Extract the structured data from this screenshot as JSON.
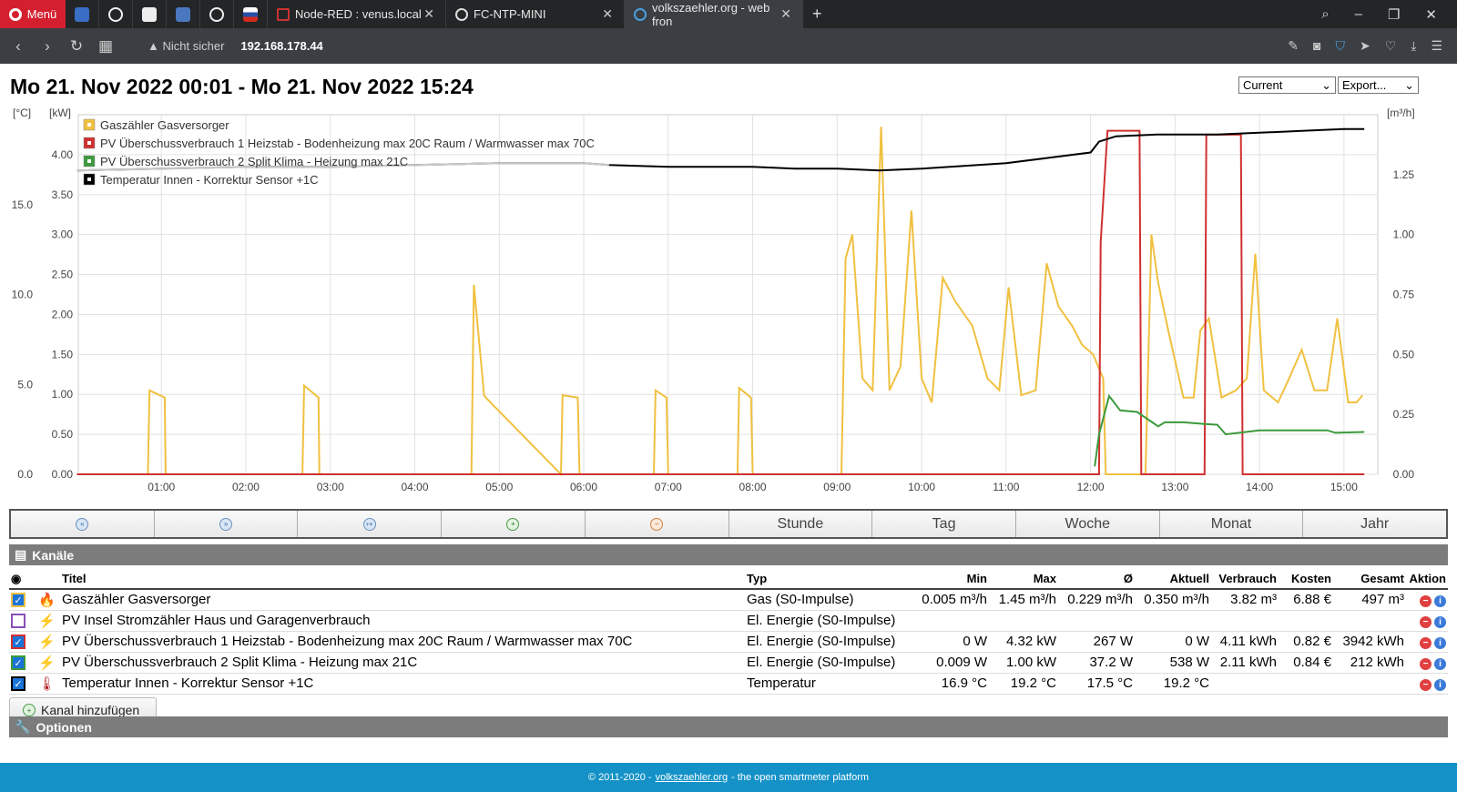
{
  "browser": {
    "menu_label": "Menü",
    "tabs": [
      {
        "title": "Node-RED : venus.local",
        "close": "✕"
      },
      {
        "title": "FC-NTP-MINI",
        "close": "✕"
      },
      {
        "title": "volkszaehler.org - web fron",
        "close": "✕"
      }
    ],
    "new_tab": "+",
    "security_label": "Nicht sicher",
    "url": "192.168.178.44"
  },
  "page": {
    "title": "Mo 21. Nov 2022 00:01 - Mo 21. Nov 2022 15:24",
    "mode_select": "Current",
    "export_select": "Export..."
  },
  "chart_data": {
    "type": "line",
    "x_range": [
      "00:01",
      "15:24"
    ],
    "x_ticks": [
      "01:00",
      "02:00",
      "03:00",
      "04:00",
      "05:00",
      "06:00",
      "07:00",
      "08:00",
      "09:00",
      "10:00",
      "11:00",
      "12:00",
      "13:00",
      "14:00",
      "15:00"
    ],
    "y_axes": {
      "temp": {
        "unit": "[°C]",
        "ticks": [
          "0.0",
          "5.0",
          "10.0",
          "15.0"
        ],
        "range": [
          0,
          20
        ]
      },
      "power": {
        "unit": "[kW]",
        "ticks": [
          "0.00",
          "0.50",
          "1.00",
          "1.50",
          "2.00",
          "2.50",
          "3.00",
          "3.50",
          "4.00"
        ],
        "range": [
          0,
          4.5
        ]
      },
      "gas": {
        "unit": "[m³/h]",
        "ticks": [
          "0.00",
          "0.25",
          "0.50",
          "0.75",
          "1.00",
          "1.25"
        ],
        "range": [
          0,
          1.5
        ]
      }
    },
    "legend_position": "top-left",
    "series": [
      {
        "name": "Gaszähler Gasversorger",
        "color": "#f0c040",
        "axis": "gas",
        "x": [
          0,
          0.84,
          0.86,
          1.04,
          1.05,
          2.67,
          2.69,
          2.86,
          2.87,
          4.67,
          4.7,
          4.82,
          4.84,
          5.73,
          5.75,
          5.93,
          5.95,
          6.83,
          6.85,
          6.98,
          7.0,
          7.82,
          7.84,
          7.98,
          8.0,
          9.05,
          9.1,
          9.18,
          9.3,
          9.42,
          9.52,
          9.62,
          9.75,
          9.88,
          10.0,
          10.12,
          10.25,
          10.4,
          10.6,
          10.78,
          10.92,
          11.03,
          11.18,
          11.35,
          11.48,
          11.62,
          11.78,
          11.9,
          12.03,
          12.15,
          12.18,
          12.65,
          12.72,
          12.8,
          12.92,
          13.1,
          13.22,
          13.3,
          13.4,
          13.55,
          13.72,
          13.85,
          13.95,
          14.05,
          14.22,
          14.35,
          14.5,
          14.65,
          14.8,
          14.92,
          15.05,
          15.15,
          15.22
        ],
        "y": [
          0,
          0,
          0.35,
          0.32,
          0,
          0,
          0.37,
          0.32,
          0,
          0,
          0.79,
          0.33,
          0.32,
          0,
          0.33,
          0.32,
          0,
          0,
          0.35,
          0.32,
          0,
          0,
          0.36,
          0.32,
          0,
          0,
          0.9,
          1.0,
          0.4,
          0.35,
          1.45,
          0.35,
          0.45,
          1.1,
          0.4,
          0.3,
          0.82,
          0.72,
          0.62,
          0.4,
          0.35,
          0.78,
          0.33,
          0.35,
          0.88,
          0.7,
          0.62,
          0.54,
          0.5,
          0.4,
          0.0,
          0.0,
          1.0,
          0.8,
          0.6,
          0.32,
          0.32,
          0.6,
          0.65,
          0.32,
          0.35,
          0.4,
          0.92,
          0.35,
          0.3,
          0.4,
          0.52,
          0.35,
          0.35,
          0.65,
          0.3,
          0.3,
          0.33
        ]
      },
      {
        "name": "PV Überschussverbrauch 1 Heizstab - Bodenheizung max 20C Raum / Warmwasser max 70C",
        "color": "#d03030",
        "axis": "power",
        "x": [
          0,
          12.1,
          12.12,
          12.2,
          12.58,
          12.6,
          13.35,
          13.37,
          13.78,
          13.8,
          15.24
        ],
        "y": [
          0,
          0,
          2.9,
          4.3,
          4.3,
          0,
          0,
          4.25,
          4.25,
          0,
          0
        ]
      },
      {
        "name": "PV Überschussverbrauch 2 Split Klima - Heizung max 21C",
        "color": "#3c9a3c",
        "axis": "power",
        "x": [
          12.05,
          12.1,
          12.22,
          12.35,
          12.55,
          12.8,
          12.88,
          13.1,
          13.35,
          13.5,
          13.6,
          14.0,
          14.5,
          14.8,
          14.9,
          15.24
        ],
        "y": [
          0.1,
          0.5,
          0.98,
          0.8,
          0.78,
          0.6,
          0.65,
          0.65,
          0.63,
          0.62,
          0.5,
          0.55,
          0.55,
          0.55,
          0.52,
          0.53
        ]
      },
      {
        "name": "Temperatur Innen - Korrektur Sensor +1C",
        "color": "#000000",
        "axis": "temp",
        "x": [
          0,
          1,
          2,
          3,
          4,
          5,
          6,
          6.3,
          7,
          8,
          8.5,
          9,
          9.5,
          10,
          11,
          11.5,
          12,
          12.1,
          12.3,
          12.8,
          13.5,
          14,
          14.5,
          15,
          15.24
        ],
        "y": [
          16.9,
          17.0,
          17.1,
          17.1,
          17.2,
          17.3,
          17.3,
          17.2,
          17.1,
          17.1,
          17.0,
          17.0,
          16.9,
          17.0,
          17.3,
          17.6,
          17.9,
          18.5,
          18.8,
          18.9,
          18.9,
          19.0,
          19.1,
          19.2,
          19.2
        ]
      }
    ]
  },
  "nav": {
    "buttons": [
      "«",
      "»",
      "↦",
      "+",
      "−",
      "Stunde",
      "Tag",
      "Woche",
      "Monat",
      "Jahr"
    ]
  },
  "channels": {
    "section_title": "Kanäle",
    "headers": {
      "title": "Titel",
      "type": "Typ",
      "min": "Min",
      "max": "Max",
      "avg": "Ø",
      "current": "Aktuell",
      "consumption": "Verbrauch",
      "cost": "Kosten",
      "total": "Gesamt",
      "action": "Aktion"
    },
    "rows": [
      {
        "color": "#f0c040",
        "checked": true,
        "icon": "flame-icon",
        "title": "Gaszähler Gasversorger",
        "type": "Gas (S0-Impulse)",
        "min": "0.005 m³/h",
        "max": "1.45 m³/h",
        "avg": "0.229 m³/h",
        "current": "0.350 m³/h",
        "consumption": "3.82 m³",
        "cost": "6.88 €",
        "total": "497 m³"
      },
      {
        "color": "#8a4fb8",
        "checked": false,
        "icon": "lightning-icon",
        "title": "PV Insel Stromzähler Haus und Garagenverbrauch",
        "type": "El. Energie (S0-Impulse)",
        "min": "",
        "max": "",
        "avg": "",
        "current": "",
        "consumption": "",
        "cost": "",
        "total": ""
      },
      {
        "color": "#d03030",
        "checked": true,
        "icon": "lightning-icon",
        "title": "PV Überschussverbrauch 1 Heizstab - Bodenheizung max 20C Raum / Warmwasser max 70C",
        "type": "El. Energie (S0-Impulse)",
        "min": "0 W",
        "max": "4.32 kW",
        "avg": "267 W",
        "current": "0 W",
        "consumption": "4.11 kWh",
        "cost": "0.82 €",
        "total": "3942 kWh"
      },
      {
        "color": "#3c9a3c",
        "checked": true,
        "icon": "lightning-icon",
        "title": "PV Überschussverbrauch 2 Split Klima - Heizung max 21C",
        "type": "El. Energie (S0-Impulse)",
        "min": "0.009 W",
        "max": "1.00 kW",
        "avg": "37.2 W",
        "current": "538 W",
        "consumption": "2.11 kWh",
        "cost": "0.84 €",
        "total": "212 kWh"
      },
      {
        "color": "#000000",
        "checked": true,
        "icon": "thermometer-icon",
        "title": "Temperatur Innen - Korrektur Sensor +1C",
        "type": "Temperatur",
        "min": "16.9 °C",
        "max": "19.2 °C",
        "avg": "17.5 °C",
        "current": "19.2 °C",
        "consumption": "",
        "cost": "",
        "total": ""
      }
    ],
    "add_button": "Kanal hinzufügen"
  },
  "options": {
    "section_title": "Optionen"
  },
  "footer": {
    "copyright": "© 2011-2020 -",
    "link": "volkszaehler.org",
    "tagline": "- the open smartmeter platform"
  }
}
